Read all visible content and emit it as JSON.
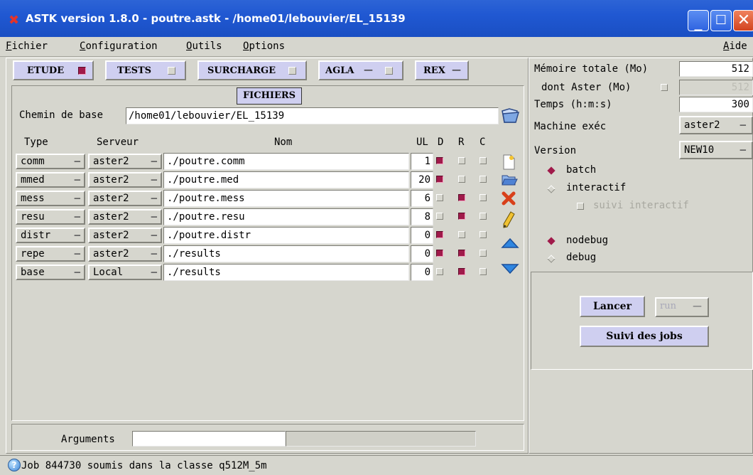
{
  "window": {
    "title": "ASTK version 1.8.0 - poutre.astk - /home01/lebouvier/EL_15139",
    "icon": "x-logo-icon"
  },
  "menu": {
    "items": [
      {
        "u": "F",
        "rest": "ichier"
      },
      {
        "u": "C",
        "rest": "onfiguration"
      },
      {
        "u": "O",
        "rest": "utils"
      },
      {
        "u": "O",
        "rest": "ptions"
      }
    ],
    "help": {
      "u": "A",
      "rest": "ide"
    }
  },
  "tabs": [
    {
      "label": "ETUDE",
      "checked": true
    },
    {
      "label": "TESTS",
      "checked": false
    },
    {
      "label": "SURCHARGE",
      "checked": false
    },
    {
      "label": "AGLA",
      "checked": false,
      "dash": "—"
    },
    {
      "label": "REX",
      "dash": "—"
    }
  ],
  "fichiers": {
    "title": "FICHIERS",
    "chemin_label": "Chemin de base",
    "chemin_value": "/home01/lebouvier/EL_15139",
    "headers": {
      "type": "Type",
      "serveur": "Serveur",
      "nom": "Nom",
      "ul": "UL",
      "d": "D",
      "r": "R",
      "c": "C"
    },
    "rows": [
      {
        "type": "comm",
        "serveur": "aster2",
        "nom": "./poutre.comm",
        "ul": "1",
        "d": true,
        "r": false,
        "c": false
      },
      {
        "type": "mmed",
        "serveur": "aster2",
        "nom": "./poutre.med",
        "ul": "20",
        "d": true,
        "r": false,
        "c": false
      },
      {
        "type": "mess",
        "serveur": "aster2",
        "nom": "./poutre.mess",
        "ul": "6",
        "d": false,
        "r": true,
        "c": false
      },
      {
        "type": "resu",
        "serveur": "aster2",
        "nom": "./poutre.resu",
        "ul": "8",
        "d": false,
        "r": true,
        "c": false
      },
      {
        "type": "distr",
        "serveur": "aster2",
        "nom": "./poutre.distr",
        "ul": "0",
        "d": true,
        "r": false,
        "c": false
      },
      {
        "type": "repe",
        "serveur": "aster2",
        "nom": "./results",
        "ul": "0",
        "d": true,
        "r": true,
        "c": false
      },
      {
        "type": "base",
        "serveur": "Local",
        "nom": "./results",
        "ul": "0",
        "d": false,
        "r": true,
        "c": false
      }
    ],
    "dash": "—"
  },
  "arguments": {
    "label": "Arguments",
    "value": ""
  },
  "right": {
    "memoire_label": "Mémoire totale (Mo)",
    "memoire_value": "512",
    "aster_label": "dont Aster (Mo)",
    "aster_value": "512",
    "temps_label": "Temps (h:m:s)",
    "temps_value": "300",
    "machine_label": "Machine exéc",
    "machine_value": "aster2",
    "version_label": "Version",
    "version_value": "NEW10",
    "mode": {
      "batch": "batch",
      "interactif": "interactif",
      "suivi": "suivi interactif",
      "selected": "batch"
    },
    "debug": {
      "nodebug": "nodebug",
      "debug": "debug",
      "selected": "nodebug"
    },
    "lancer": "Lancer",
    "run": "run",
    "suivi_jobs": "Suivi des jobs"
  },
  "status": {
    "text": "Job 844730 soumis dans la classe q512M_5m"
  }
}
